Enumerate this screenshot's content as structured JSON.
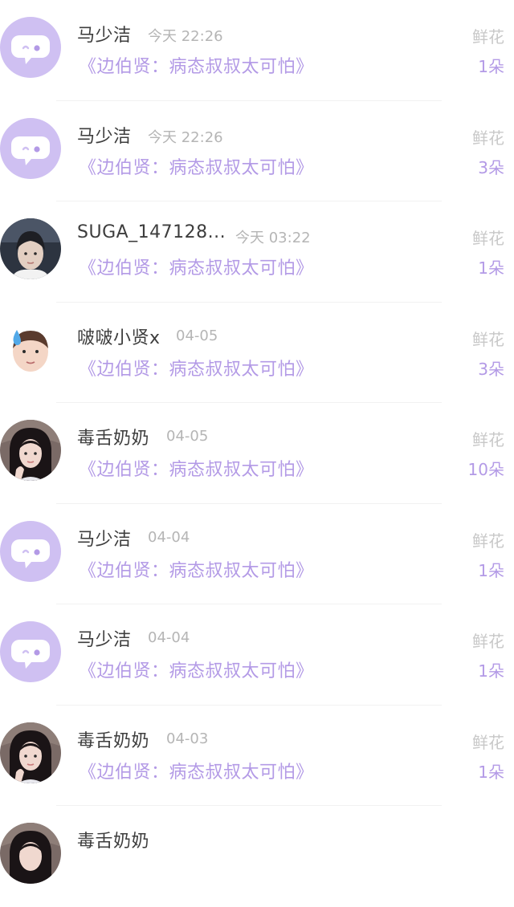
{
  "items": [
    {
      "name": "马少洁",
      "time": "今天 22:26",
      "title": "《边伯贤：病态叔叔太可怕》",
      "gift": "鲜花",
      "count": "1朵",
      "avatar": "default"
    },
    {
      "name": "马少洁",
      "time": "今天 22:26",
      "title": "《边伯贤：病态叔叔太可怕》",
      "gift": "鲜花",
      "count": "3朵",
      "avatar": "default"
    },
    {
      "name": "SUGA_147128...",
      "time": "今天 03:22",
      "title": "《边伯贤：病态叔叔太可怕》",
      "gift": "鲜花",
      "count": "1朵",
      "avatar": "photo-boy"
    },
    {
      "name": "啵啵小贤x",
      "time": "04-05",
      "title": "《边伯贤：病态叔叔太可怕》",
      "gift": "鲜花",
      "count": "3朵",
      "avatar": "sticker"
    },
    {
      "name": "毒舌奶奶",
      "time": "04-05",
      "title": "《边伯贤：病态叔叔太可怕》",
      "gift": "鲜花",
      "count": "10朵",
      "avatar": "photo-girl"
    },
    {
      "name": "马少洁",
      "time": "04-04",
      "title": "《边伯贤：病态叔叔太可怕》",
      "gift": "鲜花",
      "count": "1朵",
      "avatar": "default"
    },
    {
      "name": "马少洁",
      "time": "04-04",
      "title": "《边伯贤：病态叔叔太可怕》",
      "gift": "鲜花",
      "count": "1朵",
      "avatar": "default"
    },
    {
      "name": "毒舌奶奶",
      "time": "04-03",
      "title": "《边伯贤：病态叔叔太可怕》",
      "gift": "鲜花",
      "count": "1朵",
      "avatar": "photo-girl"
    },
    {
      "name": "毒舌奶奶",
      "time": "",
      "title": "",
      "gift": "",
      "count": "",
      "avatar": "photo-girl"
    }
  ],
  "colors": {
    "accent": "#b39ae6",
    "default_avatar": "#cfc0f2",
    "name_text": "#3d3d3d",
    "meta_text": "#b5b5b5"
  }
}
